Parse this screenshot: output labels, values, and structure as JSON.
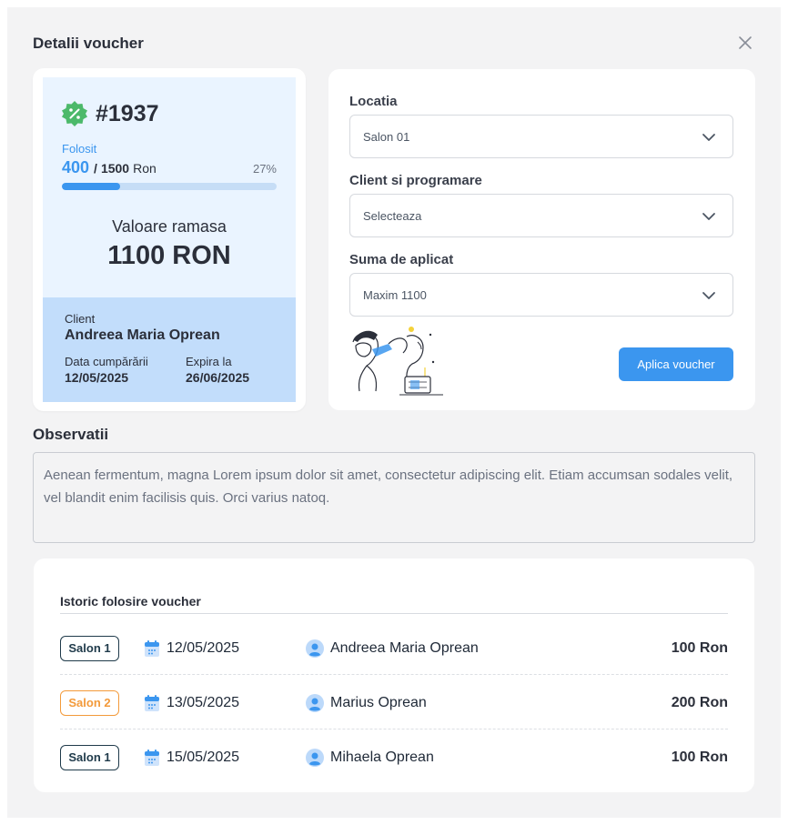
{
  "modal": {
    "title": "Detalii voucher"
  },
  "voucher": {
    "number": "#1937",
    "used_label": "Folosit",
    "used_amount": "400",
    "used_separator": "/",
    "total_amount": "1500",
    "unit": "Ron",
    "used_percent": "27%",
    "progress_fraction": 0.27,
    "remaining_label": "Valoare ramasa",
    "remaining_value": "1100 RON",
    "client_label": "Client",
    "client_name": "Andreea Maria Oprean",
    "purchase_date_label": "Data cumpărării",
    "purchase_date": "12/05/2025",
    "expiry_label": "Expira la",
    "expiry_date": "26/06/2025"
  },
  "form": {
    "location": {
      "label": "Locatia",
      "value": "Salon 01"
    },
    "client": {
      "label": "Client si programare",
      "value": "Selecteaza"
    },
    "amount": {
      "label": "Suma de aplicat",
      "value": "Maxim 1100"
    },
    "apply_button": "Aplica voucher"
  },
  "observations": {
    "title": "Observatii",
    "text": "Aenean fermentum, magna Lorem ipsum dolor sit amet, consectetur adipiscing elit. Etiam accumsan sodales velit, vel blandit enim facilisis quis. Orci varius natoq."
  },
  "history": {
    "title": "Istoric folosire voucher",
    "rows": [
      {
        "salon": "Salon 1",
        "date": "12/05/2025",
        "client": "Andreea Maria Oprean",
        "amount": "100 Ron"
      },
      {
        "salon": "Salon 2",
        "date": "13/05/2025",
        "client": "Marius Oprean",
        "amount": "200 Ron"
      },
      {
        "salon": "Salon 1",
        "date": "15/05/2025",
        "client": "Mihaela Oprean",
        "amount": "100 Ron"
      }
    ]
  },
  "colors": {
    "accent": "#3b96ef",
    "badge_green": "#4cb96a",
    "salon2_orange": "#f39a3a",
    "salon1_dark": "#1f3a4a"
  },
  "icons": {
    "close": "close-icon",
    "badge": "discount-badge-icon",
    "chevron": "chevron-down-icon",
    "calendar": "calendar-icon",
    "user": "user-avatar-icon"
  }
}
